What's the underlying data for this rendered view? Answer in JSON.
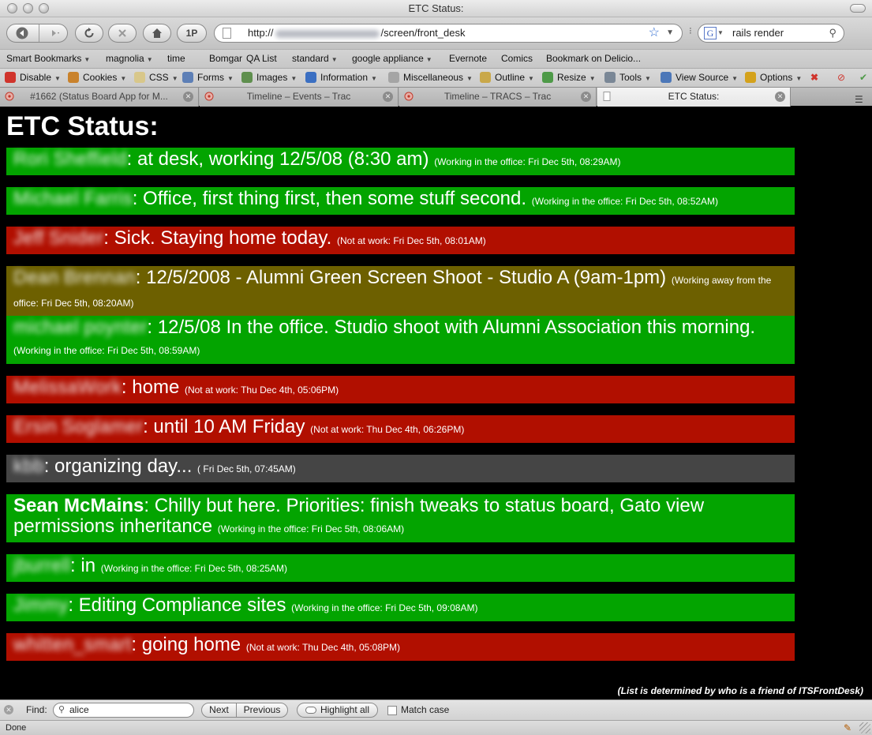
{
  "window": {
    "title": "ETC Status:"
  },
  "navigation": {
    "url_prefix": "http://",
    "url_suffix": "/screen/front_desk",
    "one_p_label": "1P",
    "search_value": "rails render",
    "search_engine_icon": "G"
  },
  "bookmarks": [
    {
      "label": "Smart Bookmarks",
      "menu": true
    },
    {
      "label": "magnolia",
      "menu": true
    },
    {
      "label": "time",
      "menu": false
    },
    {
      "label": "Bomgar",
      "menu": false
    },
    {
      "label": "QA List",
      "menu": false
    },
    {
      "label": "standard",
      "menu": true
    },
    {
      "label": "google appliance",
      "menu": true
    },
    {
      "label": "Evernote",
      "menu": false
    },
    {
      "label": "Comics",
      "menu": false
    },
    {
      "label": "Bookmark on Delicio...",
      "menu": false
    }
  ],
  "dev_toolbar": [
    {
      "label": "Disable",
      "icon": "disable-icon",
      "color": "#d0342c"
    },
    {
      "label": "Cookies",
      "icon": "cookies-icon",
      "color": "#c9822c"
    },
    {
      "label": "CSS",
      "icon": "css-icon",
      "color": "#d8c78a"
    },
    {
      "label": "Forms",
      "icon": "forms-icon",
      "color": "#5d7fb6"
    },
    {
      "label": "Images",
      "icon": "images-icon",
      "color": "#5f8f4e"
    },
    {
      "label": "Information",
      "icon": "information-icon",
      "color": "#3b6fc2"
    },
    {
      "label": "Miscellaneous",
      "icon": "miscellaneous-icon",
      "color": "#a5a5a5"
    },
    {
      "label": "Outline",
      "icon": "outline-icon",
      "color": "#c9a84a"
    },
    {
      "label": "Resize",
      "icon": "resize-icon",
      "color": "#4e9a48"
    },
    {
      "label": "Tools",
      "icon": "tools-icon",
      "color": "#7a8796"
    },
    {
      "label": "View Source",
      "icon": "view-source-icon",
      "color": "#4c77b8"
    },
    {
      "label": "Options",
      "icon": "options-icon",
      "color": "#d4a21c"
    }
  ],
  "tabs": [
    {
      "label": "#1662 (Status Board App for M...",
      "active": false
    },
    {
      "label": "Timeline – Events – Trac",
      "active": false
    },
    {
      "label": "Timeline – TRACS – Trac",
      "active": false
    },
    {
      "label": "ETC Status:",
      "active": true
    }
  ],
  "page": {
    "title": "ETC Status:",
    "footnote": "(List is determined by who is a friend of ITSFrontDesk)"
  },
  "statuses": [
    {
      "name": "Rori Sheffield",
      "blurred": true,
      "state": "working",
      "text": ": at desk, working 12/5/08 (8:30 am)",
      "meta": "(Working in the office: Fri Dec 5th, 08:29AM)"
    },
    {
      "name": "Michael Farris",
      "blurred": true,
      "state": "working",
      "text": ": Office, first thing first, then some stuff second.",
      "meta": "(Working in the office: Fri Dec 5th, 08:52AM)"
    },
    {
      "name": "Jeff Snider",
      "blurred": true,
      "state": "notatwork",
      "text": ": Sick. Staying home today.",
      "meta": "(Not at work: Fri Dec 5th, 08:01AM)"
    },
    {
      "name": "Dean Brennan",
      "blurred": true,
      "state": "away",
      "text": ": 12/5/2008 - Alumni Green Screen Shoot - Studio A (9am-1pm)",
      "meta": "(Working away from the office: Fri Dec 5th, 08:20AM)"
    },
    {
      "name": "michael poynter",
      "blurred": true,
      "state": "working",
      "text": ": 12/5/08 In the office. Studio shoot with Alumni Association this morning.",
      "meta": "(Working in the office: Fri Dec 5th, 08:59AM)"
    },
    {
      "name": "MelissaWork",
      "blurred": true,
      "state": "notatwork",
      "text": ": home",
      "meta": "(Not at work: Thu Dec 4th, 05:06PM)"
    },
    {
      "name": "Ersin Soglamer",
      "blurred": true,
      "state": "notatwork",
      "text": ": until 10 AM Friday",
      "meta": "(Not at work: Thu Dec 4th, 06:26PM)"
    },
    {
      "name": "kbb",
      "blurred": true,
      "state": "unknown",
      "text": ": organizing day...",
      "meta": "( Fri Dec 5th, 07:45AM)"
    },
    {
      "name": "Sean McMains",
      "blurred": false,
      "state": "working",
      "text": ": Chilly but here. Priorities: finish tweaks to status board, Gato view permissions inheritance",
      "meta": "(Working in the office: Fri Dec 5th, 08:06AM)"
    },
    {
      "name": "jburrell",
      "blurred": true,
      "state": "working",
      "text": ": in",
      "meta": "(Working in the office: Fri Dec 5th, 08:25AM)"
    },
    {
      "name": "Jimmy",
      "blurred": true,
      "state": "working",
      "text": ": Editing Compliance sites",
      "meta": "(Working in the office: Fri Dec 5th, 09:08AM)"
    },
    {
      "name": "whitten_smart",
      "blurred": true,
      "state": "notatwork",
      "text": ": going home",
      "meta": "(Not at work: Thu Dec 4th, 05:08PM)"
    }
  ],
  "colors": {
    "working": "#03a400",
    "notatwork": "#b10f00",
    "away": "#6d6000",
    "unknown": "#454545"
  },
  "find_bar": {
    "label": "Find:",
    "value": "alice",
    "next_label": "Next",
    "previous_label": "Previous",
    "highlight_all_label": "Highlight all",
    "match_case_label": "Match case"
  },
  "status_bar": {
    "text": "Done"
  }
}
